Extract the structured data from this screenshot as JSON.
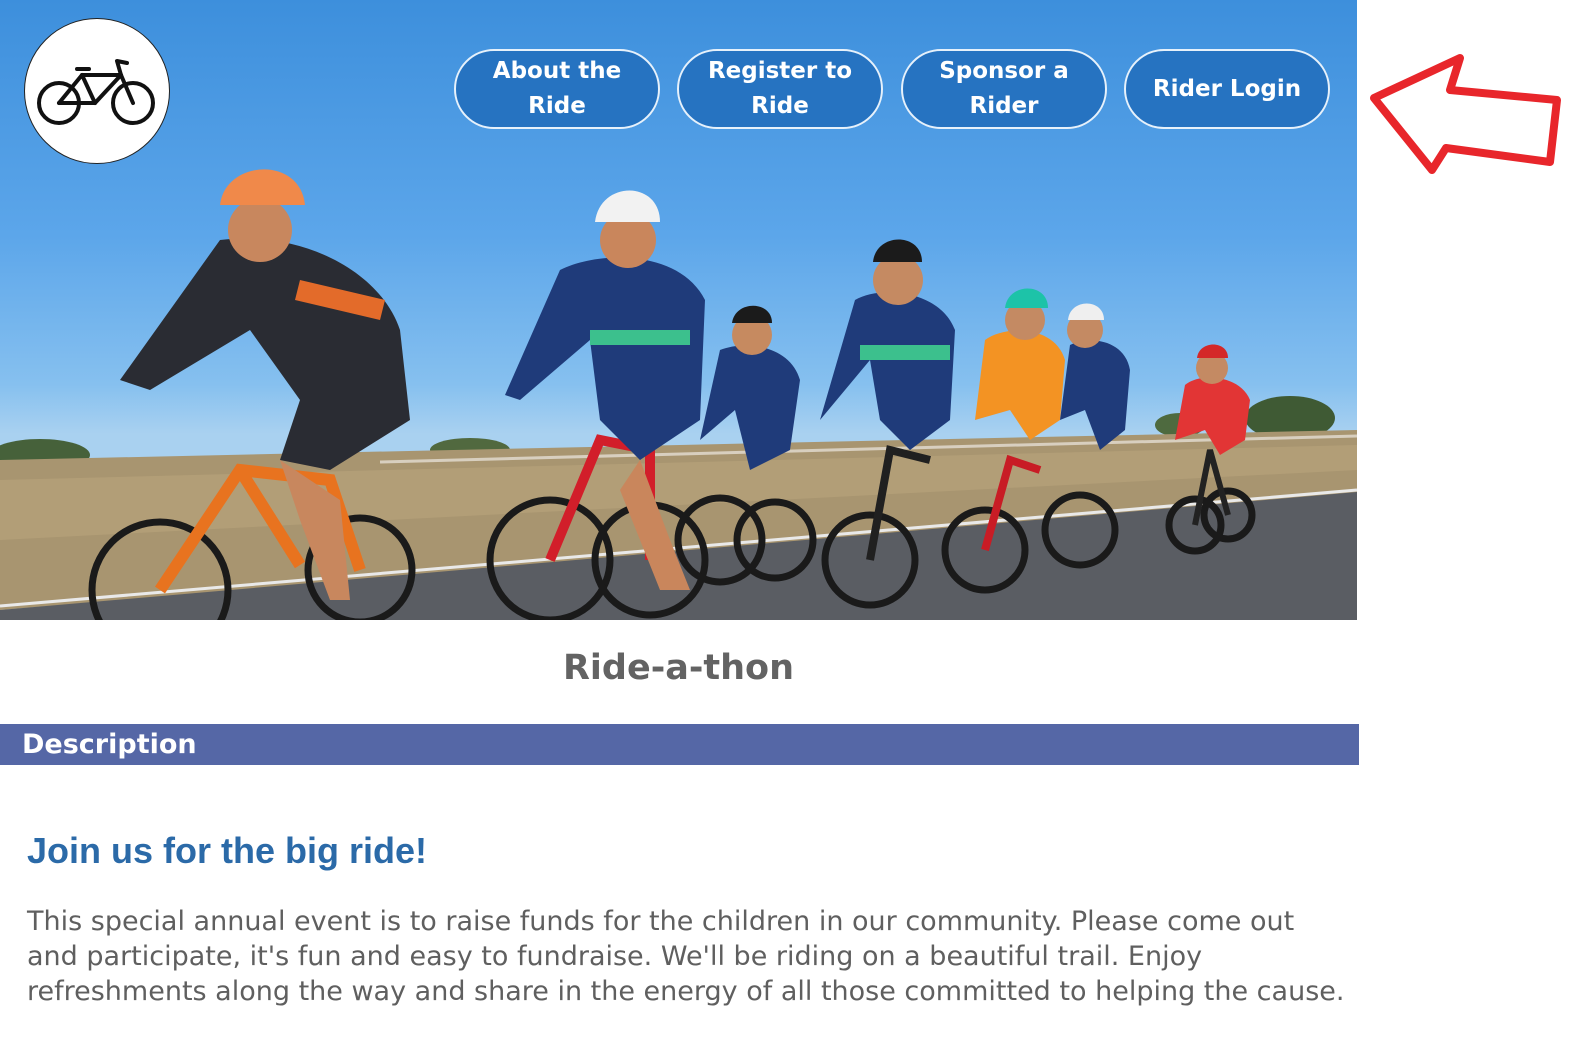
{
  "header": {
    "logo_icon": "bicycle-icon",
    "nav": [
      {
        "label": "About the Ride"
      },
      {
        "label": "Register to Ride"
      },
      {
        "label": "Sponsor a Rider"
      },
      {
        "label": "Rider Login"
      }
    ],
    "nav_color": "#2673c1"
  },
  "annotation": {
    "icon": "red-arrow-icon",
    "color": "#e8262b"
  },
  "hero": {
    "image_icon": "cyclists-photo"
  },
  "main": {
    "site_title": "Ride-a-thon",
    "section_title": "Description",
    "section_color": "#5567a6",
    "headline": "Join us for the big ride!",
    "headline_color": "#2b6aa8",
    "body": "This special annual event is to raise funds for the children in our community. Please come out and participate, it's fun and easy to fundraise. We'll be riding on a beautiful trail. Enjoy refreshments along the way and share in the energy of all those committed to helping the cause."
  }
}
